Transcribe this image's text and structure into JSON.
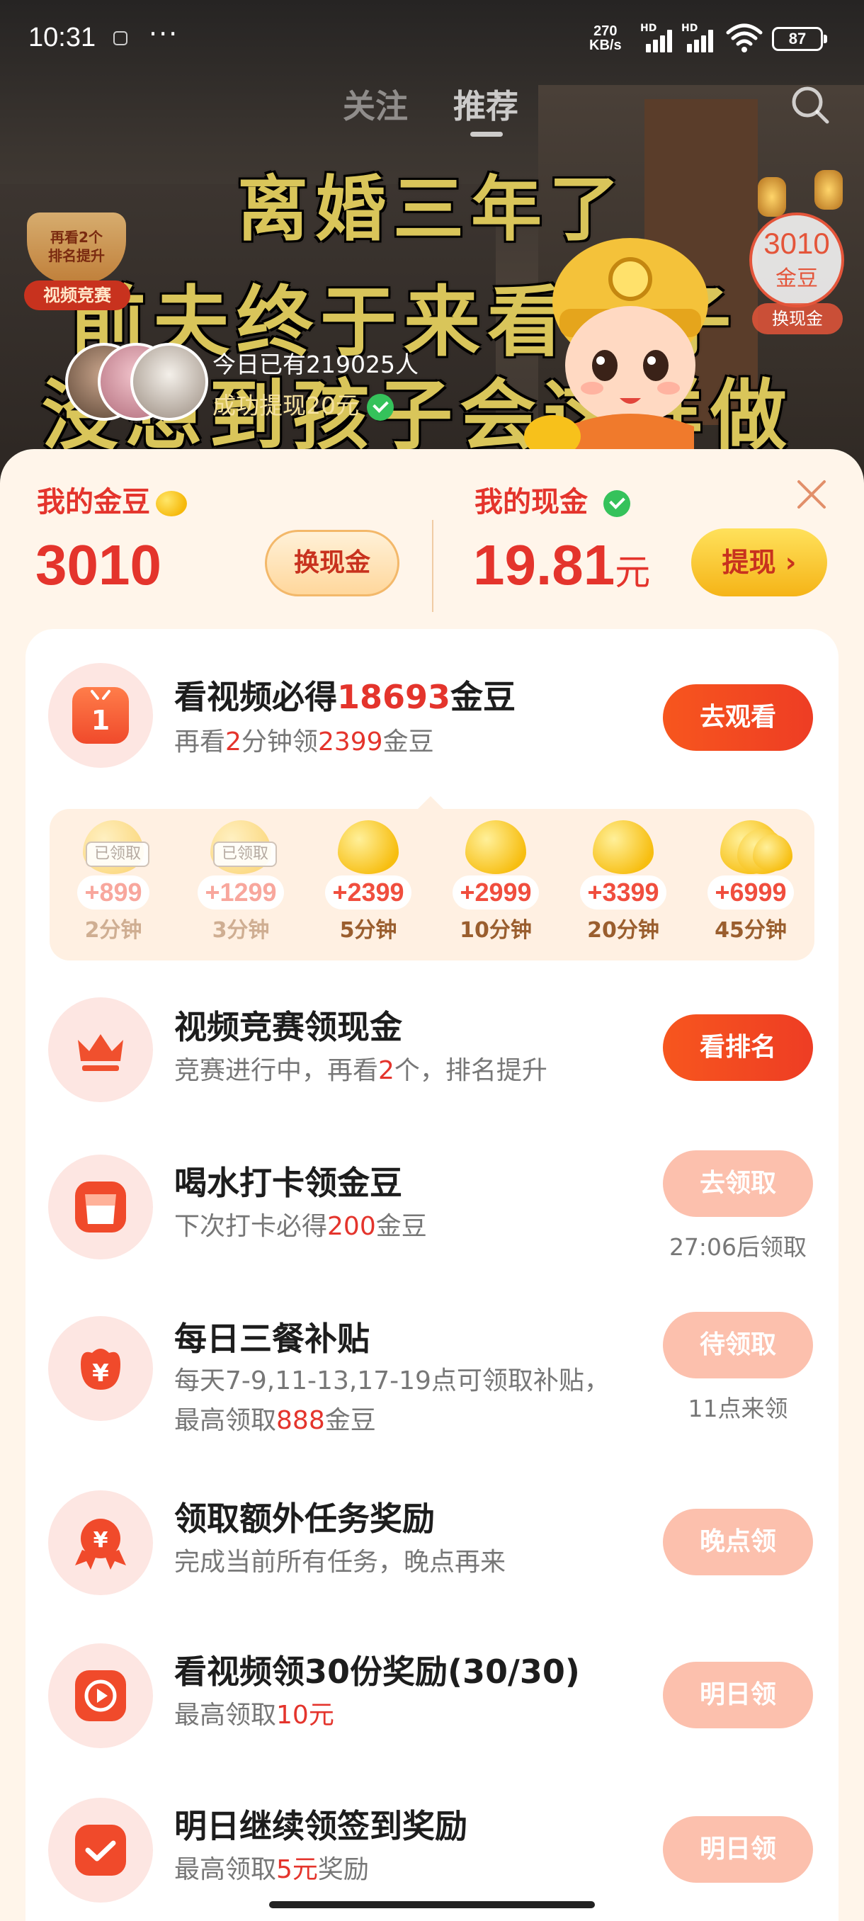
{
  "status_bar": {
    "time": "10:31",
    "dots": "···",
    "net_speed_value": "270",
    "net_speed_unit": "KB/s",
    "sim1": "HD",
    "sim2": "HD",
    "battery": "87"
  },
  "top_tabs": [
    {
      "label": "关注"
    },
    {
      "label": "推荐",
      "selected": true
    }
  ],
  "video": {
    "caption_lines": [
      "离婚三年了",
      "前夫终于来看孩子",
      "没想到孩子会这样做"
    ],
    "rank_badge": {
      "line1": "再看2个",
      "line2": "排名提升",
      "pill": "视频竞赛"
    },
    "gold_badge": {
      "value": "3010",
      "label": "金豆",
      "tag": "换现金"
    },
    "notice": {
      "line1": "今日已有219025人",
      "line2": "成功提现20元"
    }
  },
  "wallet": {
    "gold_label": "我的金豆",
    "gold_value": "3010",
    "exchange_button": "换现金",
    "cash_label": "我的现金",
    "cash_value": "19.81",
    "cash_unit": "元",
    "withdraw_button": "提现"
  },
  "tasks": {
    "watch": {
      "title_pre": "看视频必得",
      "title_num": "18693",
      "title_post": "金豆",
      "sub_pre": "再看",
      "sub_num1": "2",
      "sub_mid": "分钟领",
      "sub_num2": "2399",
      "sub_post": "金豆",
      "button": "去观看",
      "steps": [
        {
          "amount": "+899",
          "duration": "2分钟",
          "claimed": true,
          "tag": "已领取"
        },
        {
          "amount": "+1299",
          "duration": "3分钟",
          "claimed": true,
          "tag": "已领取"
        },
        {
          "amount": "+2399",
          "duration": "5分钟",
          "claimed": false
        },
        {
          "amount": "+2999",
          "duration": "10分钟",
          "claimed": false
        },
        {
          "amount": "+3399",
          "duration": "20分钟",
          "claimed": false
        },
        {
          "amount": "+6999",
          "duration": "45分钟",
          "claimed": false
        }
      ]
    },
    "contest": {
      "title": "视频竞赛领现金",
      "sub_pre": "竞赛进行中，再看",
      "sub_num": "2",
      "sub_post": "个，排名提升",
      "button": "看排名"
    },
    "water": {
      "title": "喝水打卡领金豆",
      "sub_pre": "下次打卡必得",
      "sub_num": "200",
      "sub_post": "金豆",
      "button": "去领取",
      "note": "27:06后领取"
    },
    "meals": {
      "title": "每日三餐补贴",
      "sub_line1": "每天7-9,11-13,17-19点可领取补贴，",
      "sub_pre": "最高领取",
      "sub_num": "888",
      "sub_post": "金豆",
      "button": "待领取",
      "note": "11点来领"
    },
    "extra": {
      "title": "领取额外任务奖励",
      "sub": "完成当前所有任务，晚点再来",
      "button": "晚点领"
    },
    "thirty": {
      "title": "看视频领30份奖励(30/30)",
      "sub_pre": "最高领取",
      "sub_num": "10元",
      "button": "明日领"
    },
    "signin": {
      "title": "明日继续领签到奖励",
      "sub_pre": "最高领取",
      "sub_num": "5元",
      "sub_post": "奖励",
      "button": "明日领"
    }
  },
  "colors": {
    "accent_red": "#e4342c",
    "button_orange": "#f04a2b",
    "muted_button": "#fcc0ad",
    "sheet_bg": "#fff5ea",
    "gold": "#f7be10"
  },
  "icons": [
    "search-icon",
    "close-icon",
    "tv-icon",
    "crown-icon",
    "cup-icon",
    "yuan-pouch-icon",
    "yuan-ribbon-icon",
    "play-icon",
    "check-icon",
    "bean-icon",
    "wifi-icon"
  ]
}
